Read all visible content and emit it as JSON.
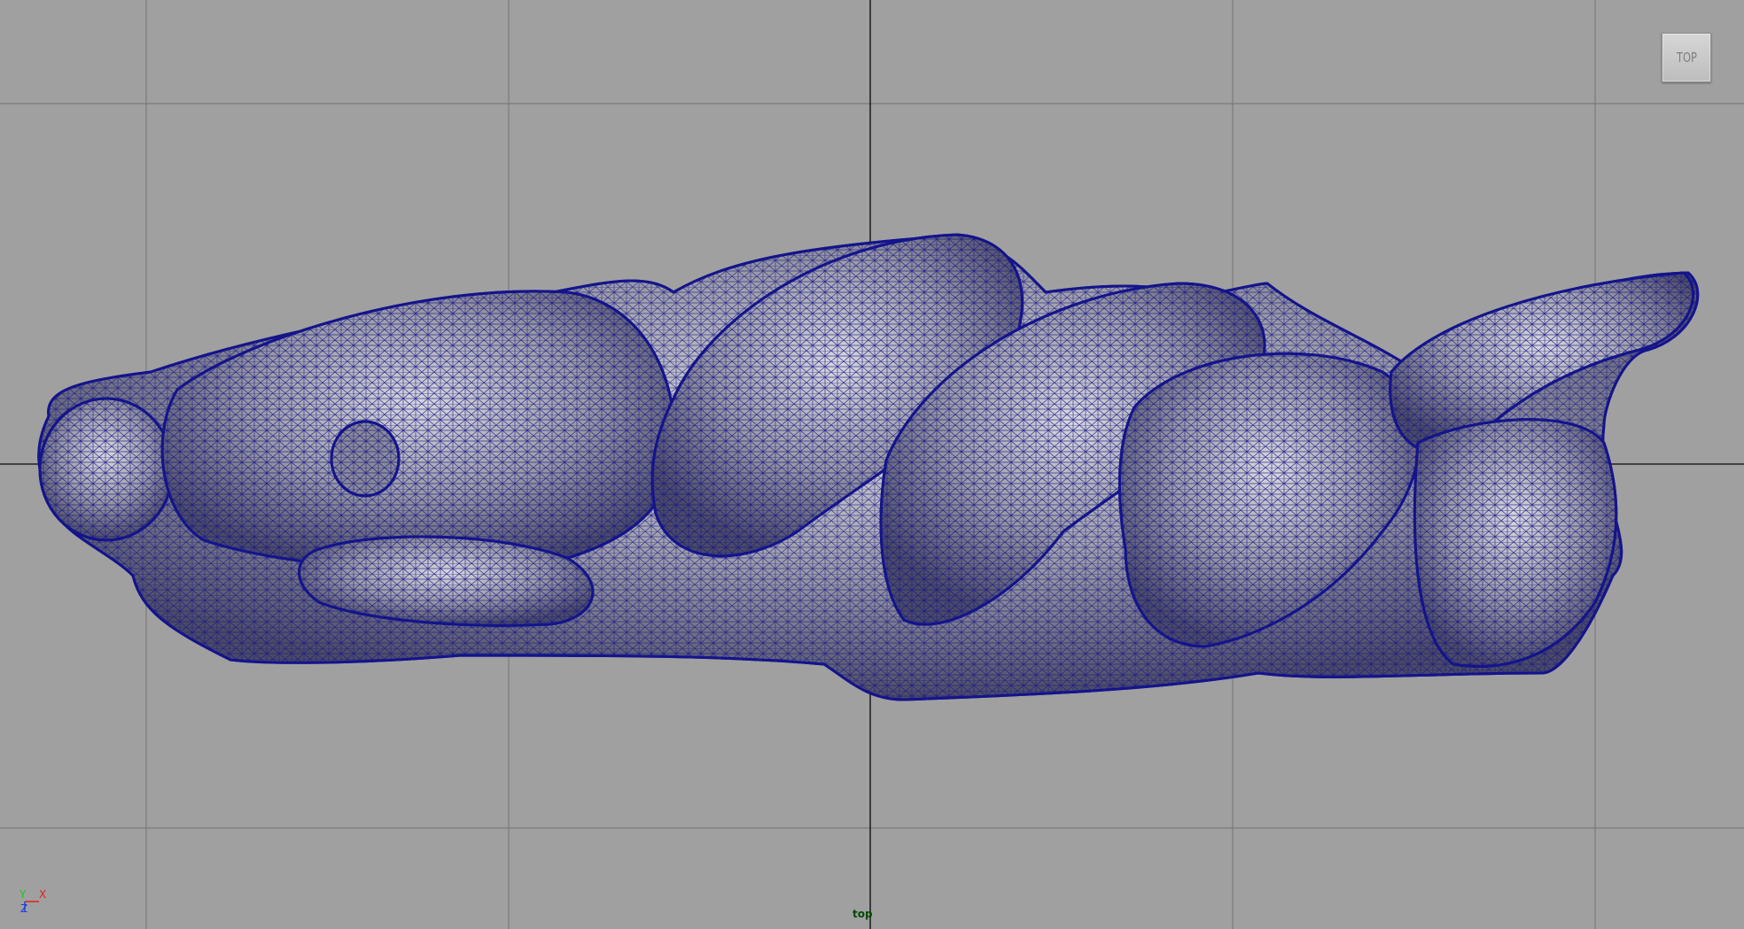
{
  "viewport": {
    "background_color": "#a0a0a0",
    "grid_color": "#7a7a7a",
    "axis_line_color": "#222222",
    "wireframe_color": "#14148c"
  },
  "view_cube": {
    "label": "TOP"
  },
  "camera": {
    "name": "top"
  },
  "axis_gizmo": {
    "x_label": "X",
    "y_label": "Y",
    "z_label": "Z",
    "x_color": "#e02020",
    "y_color": "#20c020",
    "z_color": "#2040e0"
  }
}
